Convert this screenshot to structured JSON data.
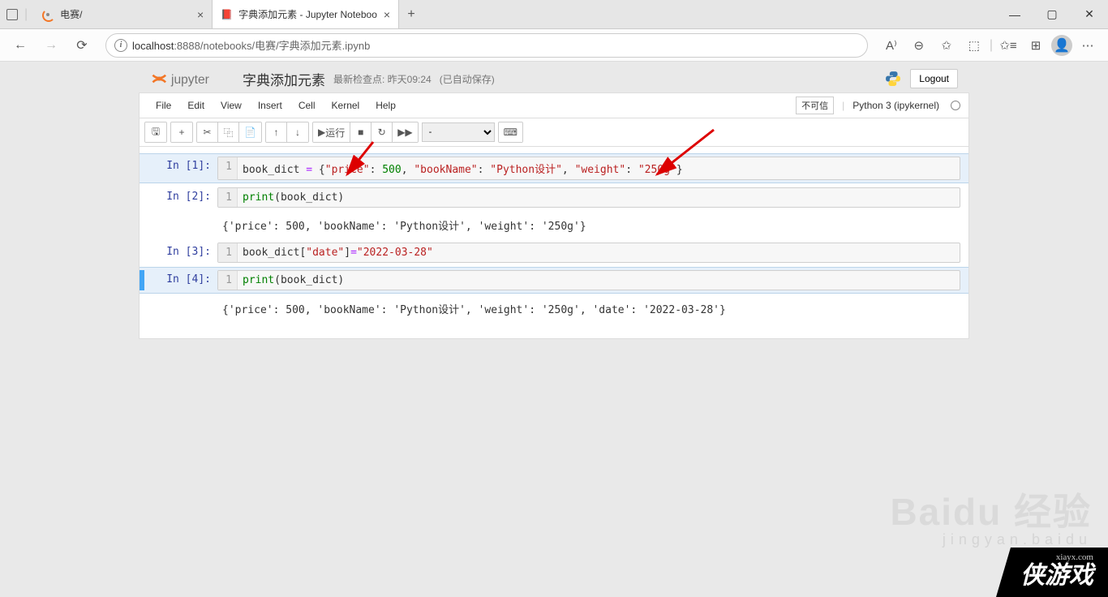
{
  "browser": {
    "tabs": [
      {
        "title": "电赛/",
        "favicon": "jupyter"
      },
      {
        "title": "字典添加元素 - Jupyter Noteboo",
        "favicon": "notebook",
        "active": true
      }
    ],
    "url_host": "localhost",
    "url_port": ":8888",
    "url_path": "/notebooks/电赛/字典添加元素.ipynb"
  },
  "notebook": {
    "brand": "jupyter",
    "title": "字典添加元素",
    "checkpoint": "最新检查点: 昨天09:24",
    "autosave": "(已自动保存)",
    "logout": "Logout",
    "menus": [
      "File",
      "Edit",
      "View",
      "Insert",
      "Cell",
      "Kernel",
      "Help"
    ],
    "trusted": "不可信",
    "kernel": "Python 3 (ipykernel)",
    "run_label": "运行",
    "celltype_placeholder": "-"
  },
  "cells": [
    {
      "prompt": "In [1]:",
      "lineno": "1",
      "code_html": "book_dict <span class='s-op'>=</span> {<span class='s-str'>\"price\"</span>: <span class='s-num'>500</span>, <span class='s-str'>\"bookName\"</span>: <span class='s-str'>\"Python设计\"</span>, <span class='s-str'>\"weight\"</span>: <span class='s-str'>\"250g\"</span>}",
      "selected": true
    },
    {
      "prompt": "In [2]:",
      "lineno": "1",
      "code_html": "<span class='s-builtin'>print</span>(book_dict)",
      "output": "{'price': 500, 'bookName': 'Python设计', 'weight': '250g'}"
    },
    {
      "prompt": "In [3]:",
      "lineno": "1",
      "code_html": "book_dict[<span class='s-str'>\"date\"</span>]<span class='s-op'>=</span><span class='s-str'>\"2022-03-28\"</span>"
    },
    {
      "prompt": "In [4]:",
      "lineno": "1",
      "code_html": "<span class='s-builtin'>print</span>(book_dict)",
      "output": "{'price': 500, 'bookName': 'Python设计', 'weight': '250g', 'date': '2022-03-28'}",
      "focus": true
    }
  ],
  "watermark": {
    "brand": "Baidu 经验",
    "sub": "jingyan.baidu",
    "corner_small": "xiayx.com",
    "corner_large": "侠游戏"
  }
}
